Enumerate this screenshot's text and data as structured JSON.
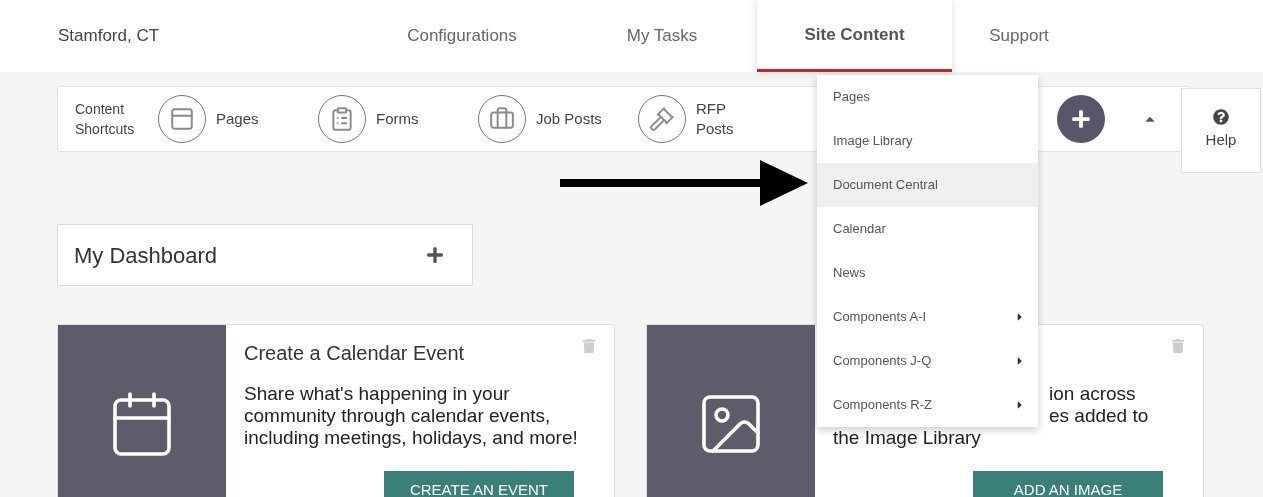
{
  "nav": {
    "location": "Stamford, CT",
    "tabs": [
      {
        "label": "Configurations",
        "selected": false
      },
      {
        "label": "My Tasks",
        "selected": false
      },
      {
        "label": "Site Content",
        "selected": true
      },
      {
        "label": "Support",
        "selected": false
      }
    ]
  },
  "shortcuts": {
    "label": "Content Shortcuts",
    "items": [
      {
        "kind": "pages",
        "label": "Pages"
      },
      {
        "kind": "forms",
        "label": "Forms"
      },
      {
        "kind": "jobs",
        "label": "Job Posts"
      },
      {
        "kind": "rfp",
        "label": "RFP Posts"
      }
    ]
  },
  "help": {
    "label": "Help"
  },
  "dropdown": {
    "items": [
      {
        "label": "Pages",
        "selected": false,
        "submenu": false
      },
      {
        "label": "Image Library",
        "selected": false,
        "submenu": false
      },
      {
        "label": "Document Central",
        "selected": true,
        "submenu": false
      },
      {
        "label": "Calendar",
        "selected": false,
        "submenu": false
      },
      {
        "label": "News",
        "selected": false,
        "submenu": false
      },
      {
        "label": "Components A-I",
        "selected": false,
        "submenu": true
      },
      {
        "label": "Components J-Q",
        "selected": false,
        "submenu": true
      },
      {
        "label": "Components R-Z",
        "selected": false,
        "submenu": true
      }
    ]
  },
  "dashboard": {
    "title": "My Dashboard"
  },
  "cards": [
    {
      "kind": "calendar",
      "title": "Create a Calendar Event",
      "description": "Share what's happening in your community through calendar events, including meetings, holidays, and more!",
      "button": "CREATE AN EVENT"
    },
    {
      "kind": "image",
      "fragments": [
        "ion across",
        "es added to"
      ],
      "description": "the Image Library",
      "button": "ADD AN IMAGE"
    }
  ]
}
